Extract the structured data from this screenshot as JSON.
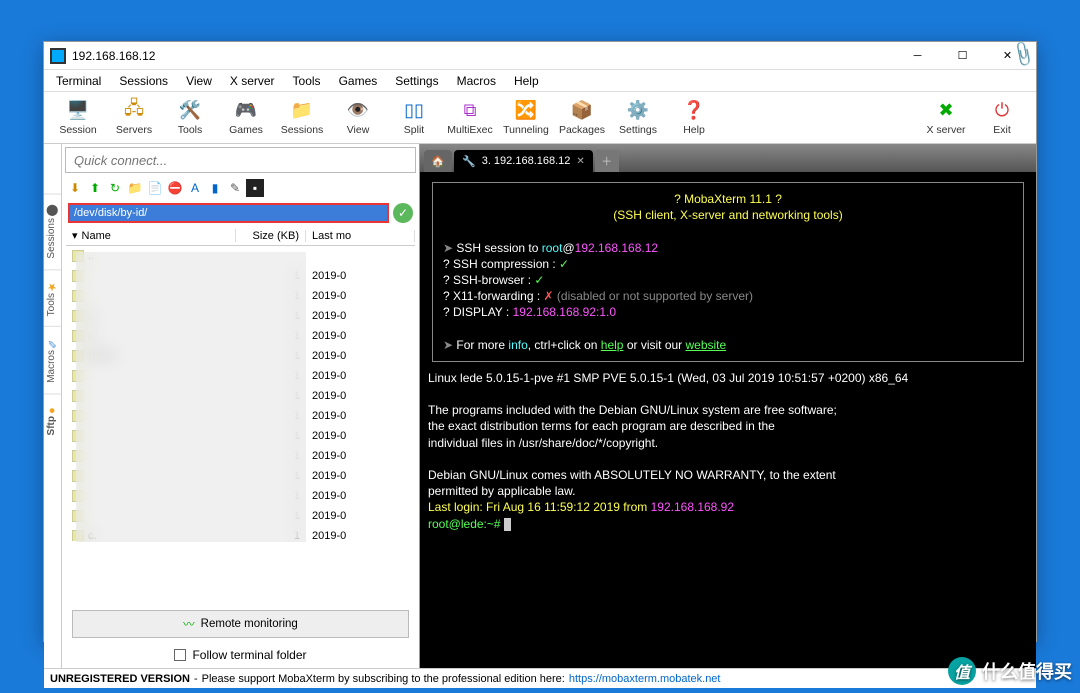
{
  "window": {
    "title": "192.168.168.12"
  },
  "menu": [
    "Terminal",
    "Sessions",
    "View",
    "X server",
    "Tools",
    "Games",
    "Settings",
    "Macros",
    "Help"
  ],
  "toolbar": [
    {
      "label": "Session",
      "icon": "🖥️",
      "color": "#d44"
    },
    {
      "label": "Servers",
      "icon": "🖧",
      "color": "#c80"
    },
    {
      "label": "Tools",
      "icon": "🛠️",
      "color": "#c60"
    },
    {
      "label": "Games",
      "icon": "🎮",
      "color": "#0a0"
    },
    {
      "label": "Sessions",
      "icon": "📁",
      "color": "#c90"
    },
    {
      "label": "View",
      "icon": "👁️",
      "color": "#09c"
    },
    {
      "label": "Split",
      "icon": "▯▯",
      "color": "#06c"
    },
    {
      "label": "MultiExec",
      "icon": "⧉",
      "color": "#a3c"
    },
    {
      "label": "Tunneling",
      "icon": "🔀",
      "color": "#08a"
    },
    {
      "label": "Packages",
      "icon": "📦",
      "color": "#c80"
    },
    {
      "label": "Settings",
      "icon": "⚙️",
      "color": "#09c"
    },
    {
      "label": "Help",
      "icon": "❓",
      "color": "#08c"
    }
  ],
  "toolbar_right": [
    {
      "label": "X server",
      "icon": "✖",
      "color": "#0a0"
    },
    {
      "label": "Exit",
      "icon": "⏻",
      "color": "#d33"
    }
  ],
  "quick_connect_placeholder": "Quick connect...",
  "side_tabs": [
    "Sessions",
    "Tools",
    "Macros",
    "Sftp"
  ],
  "sftp_path": "/dev/disk/by-id/",
  "file_table": {
    "headers": {
      "name": "Name",
      "size": "Size (KB)",
      "last": "Last mo"
    },
    "rows": [
      {
        "name": "..",
        "size": "",
        "last": ""
      },
      {
        "name": "",
        "size": "1",
        "last": "2019-0"
      },
      {
        "name": "",
        "size": "1",
        "last": "2019-0"
      },
      {
        "name": "a",
        "size": "1",
        "last": "2019-0"
      },
      {
        "name": "a",
        "size": "1",
        "last": "2019-0"
      },
      {
        "name": "D               Z6...",
        "size": "1",
        "last": "2019-0"
      },
      {
        "name": "",
        "size": "1",
        "last": "2019-0"
      },
      {
        "name": "",
        "size": "1",
        "last": "2019-0"
      },
      {
        "name": "",
        "size": "1",
        "last": "2019-0"
      },
      {
        "name": "",
        "size": "1",
        "last": "2019-0"
      },
      {
        "name": "",
        "size": "1",
        "last": "2019-0"
      },
      {
        "name": "",
        "size": "1",
        "last": "2019-0"
      },
      {
        "name": "",
        "size": "1",
        "last": "2019-0"
      },
      {
        "name": "",
        "size": "1",
        "last": "2019-0"
      },
      {
        "name": "c.",
        "size": "1",
        "last": "2019-0"
      }
    ]
  },
  "remote_monitoring": "Remote monitoring",
  "follow_terminal": "Follow terminal folder",
  "tabs": {
    "active": "3. 192.168.168.12"
  },
  "term": {
    "banner1": "? MobaXterm 11.1 ?",
    "banner2": "(SSH client, X-server and networking tools)",
    "ssh_to_pre": "SSH session to ",
    "ssh_user": "root",
    "ssh_at": "@",
    "ssh_host": "192.168.168.12",
    "compression": "? SSH compression : ",
    "compression_v": "✓",
    "browser": "? SSH-browser     : ",
    "browser_v": "✓",
    "x11": "? X11-forwarding  : ",
    "x11_v": "✗",
    "x11_note": "  (disabled or not supported by server)",
    "display": "? DISPLAY         : ",
    "display_v": "192.168.168.92:1.0",
    "moreinfo_pre": "For more ",
    "info": "info",
    "moreinfo_mid": ", ctrl+click on ",
    "help": "help",
    "moreinfo_mid2": " or visit our ",
    "website": "website",
    "uname": "Linux lede 5.0.15-1-pve #1 SMP PVE 5.0.15-1 (Wed, 03 Jul 2019 10:51:57 +0200) x86_64",
    "p1": "The programs included with the Debian GNU/Linux system are free software;",
    "p2": "the exact distribution terms for each program are described in the",
    "p3": "individual files in /usr/share/doc/*/copyright.",
    "p4": "Debian GNU/Linux comes with ABSOLUTELY NO WARRANTY, to the extent",
    "p5": "permitted by applicable law.",
    "lastlogin_pre": "Last login: ",
    "lastlogin": "Fri Aug 16 11:59:12 2019 from ",
    "lastlogin_ip": "192.168.168.92",
    "prompt": "root@lede:~# "
  },
  "status": {
    "unreg": "UNREGISTERED VERSION",
    "sep": " - ",
    "msg": "Please support MobaXterm by subscribing to the professional edition here: ",
    "url": "https://mobaxterm.mobatek.net"
  },
  "watermark": "什么值得买"
}
